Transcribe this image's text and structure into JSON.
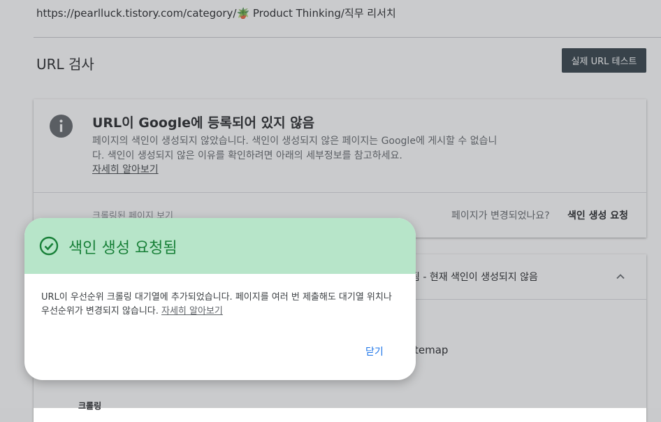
{
  "address": {
    "url": "https://pearlluck.tistory.com/category/🪴 Product Thinking/직무 리서치"
  },
  "header": {
    "title": "URL 검사",
    "live_test_label": "실제 URL 테스트"
  },
  "status_card": {
    "title": "URL이 Google에 등록되어 있지 않음",
    "description": "페이지의 색인이 생성되지 않았습니다. 색인이 생성되지 않은 페이지는 Google에 게시할 수 없습니다. 색인이 생성되지 않은 이유를 확인하려면 아래의 세부정보를 참고하세요.",
    "learn_more": "자세히 알아보기",
    "crawled_page_link": "크롤링된 페이지 보기",
    "changed_question": "페이지가 변경되었나요?",
    "request_indexing": "색인 생성 요청"
  },
  "detail_card": {
    "header_text": "됨 - 현재 색인이 생성되지 않음",
    "sitemap_text": "temap",
    "crawl_label": "크롤링"
  },
  "dialog": {
    "title": "색인 생성 요청됨",
    "body": "URL이 우선순위 크롤링 대기열에 추가되었습니다. 페이지를 여러 번 제출해도 대기열 위치나 우선순위가 변경되지 않습니다. ",
    "learn_more": "자세히 알아보기",
    "close_label": "닫기"
  },
  "colors": {
    "success_bg": "#b7e5c9",
    "success_text": "#188038",
    "button_dark": "#2e3b44",
    "link_blue": "#1a73e8"
  },
  "icons": [
    "info-icon",
    "chevron-up-icon",
    "check-circle-icon"
  ]
}
